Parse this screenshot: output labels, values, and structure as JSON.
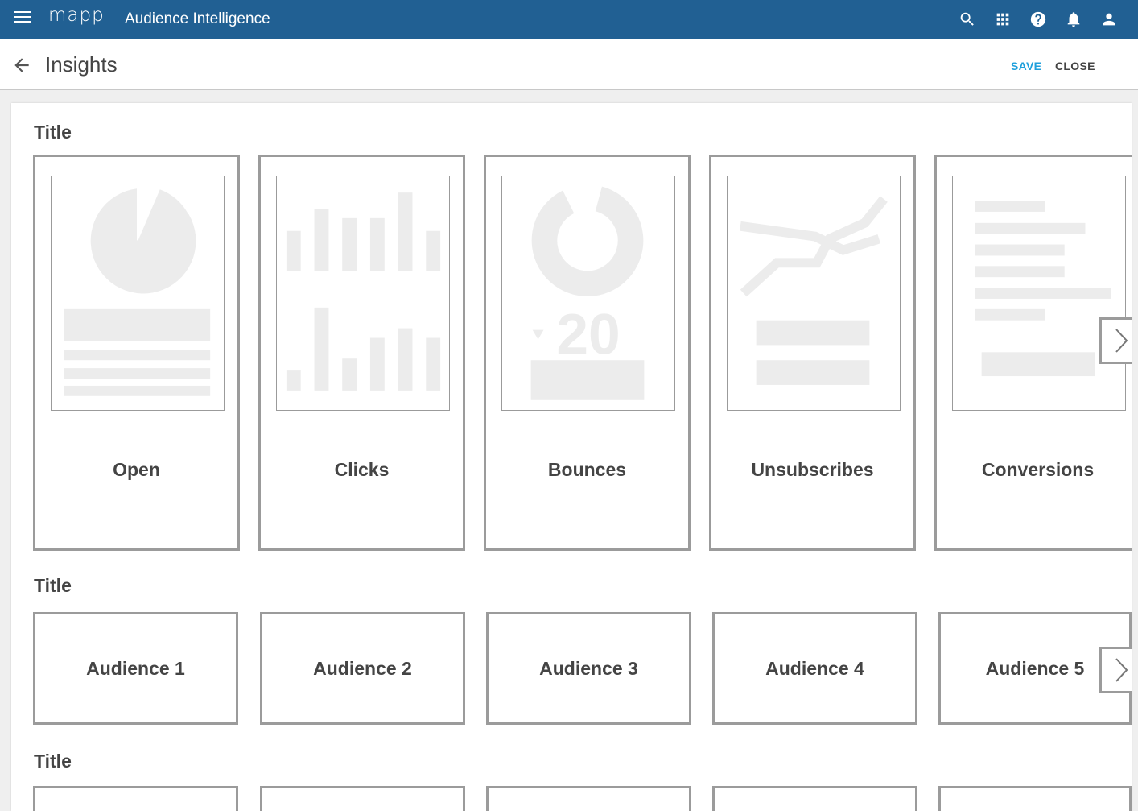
{
  "app": {
    "logo": "mapp",
    "title": "Audience Intelligence",
    "brand_color": "#216093",
    "icons": [
      "menu-icon",
      "search-icon",
      "apps-grid-icon",
      "help-icon",
      "notifications-icon",
      "account-icon"
    ]
  },
  "header": {
    "page_title": "Insights",
    "save_label": "SAVE",
    "close_label": "CLOSE",
    "save_color": "#1fa0dc"
  },
  "sections": [
    {
      "title": "Title",
      "cards": [
        {
          "label": "Open",
          "thumbnail": "pie-chart"
        },
        {
          "label": "Clicks",
          "thumbnail": "bar-chart"
        },
        {
          "label": "Bounces",
          "thumbnail": "donut-kpi",
          "kpi_value": "20"
        },
        {
          "label": "Unsubscribes",
          "thumbnail": "line-chart"
        },
        {
          "label": "Conversions",
          "thumbnail": "text-list"
        }
      ]
    },
    {
      "title": "Title",
      "cards": [
        {
          "label": "Audience 1"
        },
        {
          "label": "Audience 2"
        },
        {
          "label": "Audience 3"
        },
        {
          "label": "Audience 4"
        },
        {
          "label": "Audience 5"
        }
      ]
    },
    {
      "title": "Title",
      "cards": []
    }
  ]
}
